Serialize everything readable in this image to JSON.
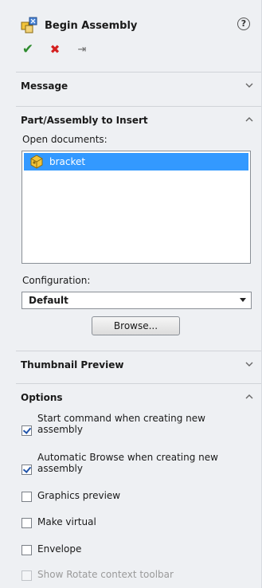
{
  "header": {
    "title": "Begin Assembly",
    "help_icon": "?",
    "actions": {
      "ok_icon": "✔",
      "cancel_icon": "✖",
      "pin_icon": "⇥"
    }
  },
  "sections": {
    "message": {
      "label": "Message",
      "state": "collapsed"
    },
    "part_insert": {
      "label": "Part/Assembly to Insert",
      "state": "expanded",
      "open_documents_label": "Open documents:",
      "documents": [
        {
          "name": "bracket",
          "selected": true
        }
      ],
      "configuration_label": "Configuration:",
      "configuration_value": "Default",
      "browse_label": "Browse..."
    },
    "thumbnail": {
      "label": "Thumbnail Preview",
      "state": "collapsed"
    },
    "options": {
      "label": "Options",
      "state": "expanded",
      "items": [
        {
          "label": "Start command when creating new assembly",
          "checked": true,
          "enabled": true
        },
        {
          "label": "Automatic Browse when creating new assembly",
          "checked": true,
          "enabled": true
        },
        {
          "label": "Graphics preview",
          "checked": false,
          "enabled": true
        },
        {
          "label": "Make virtual",
          "checked": false,
          "enabled": true
        },
        {
          "label": "Envelope",
          "checked": false,
          "enabled": true
        },
        {
          "label": "Show Rotate context toolbar",
          "checked": false,
          "enabled": false
        }
      ]
    }
  },
  "colors": {
    "panel_bg": "#eef0f3",
    "selection": "#3399ff",
    "ok_green": "#2e8b2e",
    "cancel_red": "#d42020"
  }
}
